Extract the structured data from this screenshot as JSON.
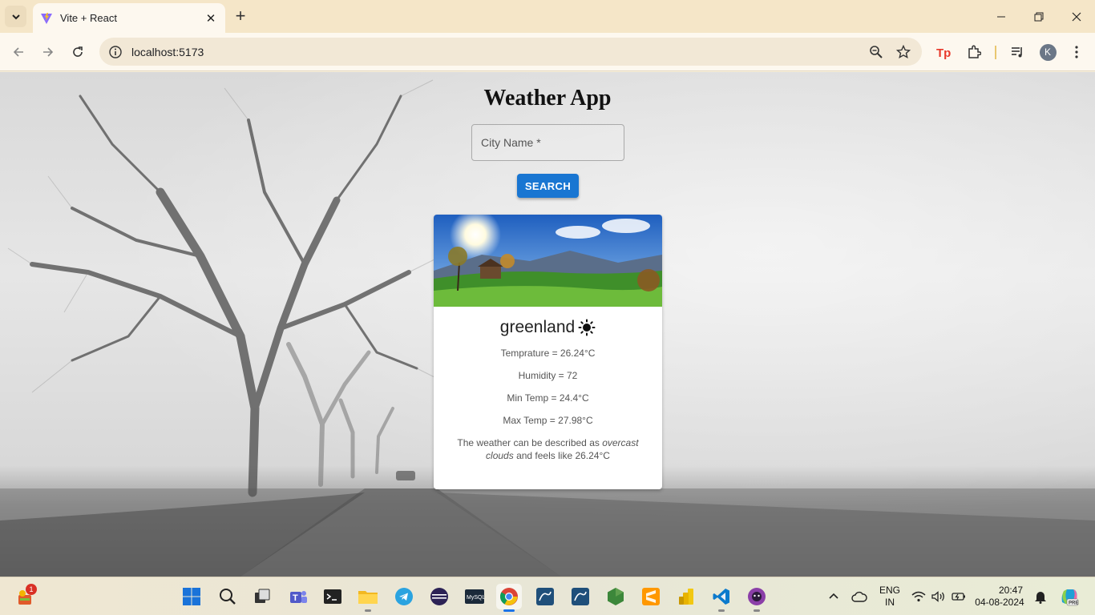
{
  "browser": {
    "tab_title": "Vite + React",
    "url": "localhost:5173",
    "profile_initial": "K"
  },
  "app": {
    "title": "Weather App",
    "city_placeholder": "City Name *",
    "search_label": "SEARCH"
  },
  "card": {
    "city": "greenland",
    "weather_icon": "sunny-icon",
    "temperature": "Temprature = 26.24°C",
    "humidity": "Humidity = 72",
    "min_temp": "Min Temp = 24.4°C",
    "max_temp": "Max Temp = 27.98°C",
    "desc_prefix": "The weather can be described as ",
    "desc_condition": "overcast clouds",
    "desc_suffix": " and feels like 26.24°C"
  },
  "taskbar": {
    "notification_count": "1",
    "language": "ENG",
    "region": "IN",
    "time": "20:47",
    "date": "04-08-2024"
  },
  "colors": {
    "accent": "#1976d2",
    "chrome_tabbar": "#f5e6c8",
    "chrome_toolbar": "#fdf8ef"
  }
}
